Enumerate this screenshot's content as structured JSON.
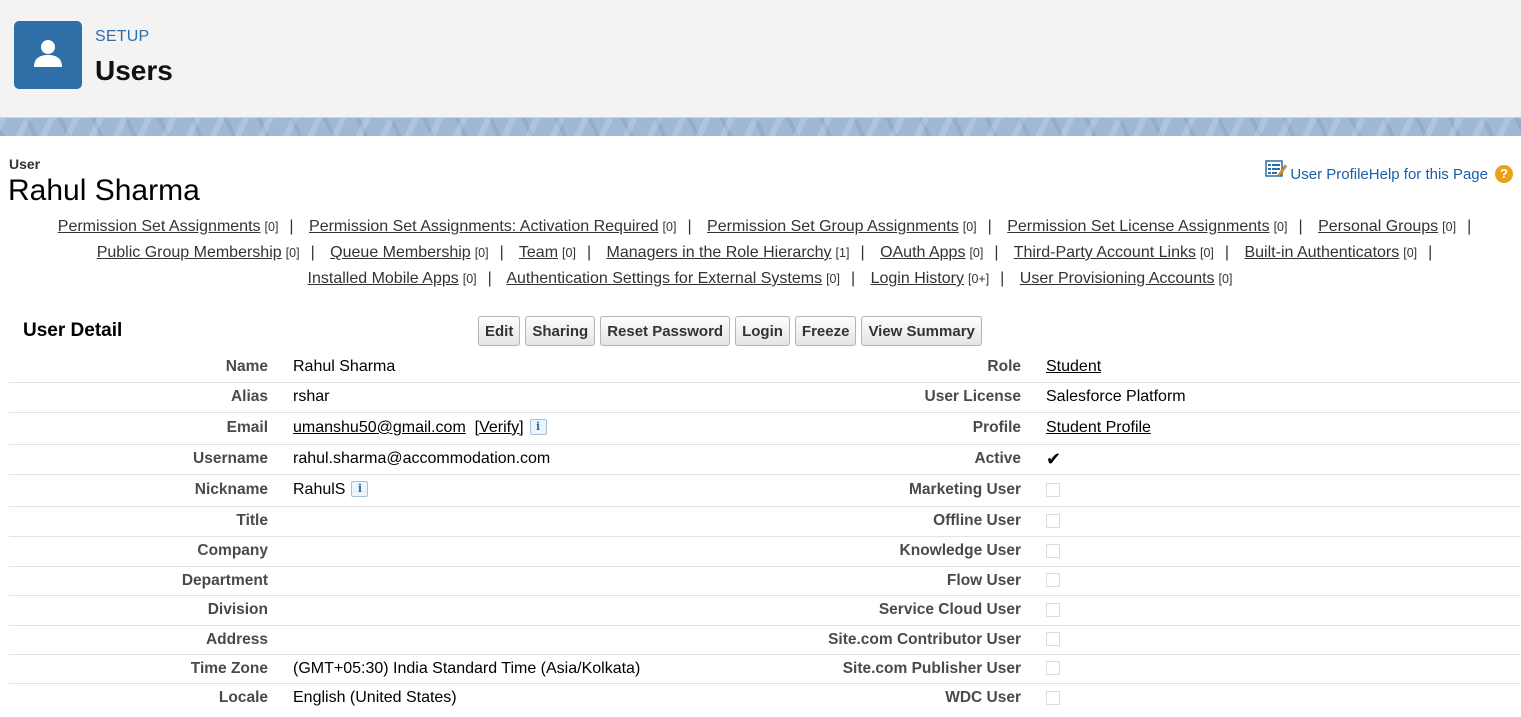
{
  "header": {
    "setup_label": "SETUP",
    "title": "Users"
  },
  "user": {
    "type_label": "User",
    "name": "Rahul Sharma"
  },
  "help": {
    "profile_link": "User Profile",
    "help_link": "Help for this Page",
    "help_symbol": "?"
  },
  "related_links": [
    {
      "label": "Permission Set Assignments",
      "count": "[0]"
    },
    {
      "label": "Permission Set Assignments: Activation Required",
      "count": "[0]"
    },
    {
      "label": "Permission Set Group Assignments",
      "count": "[0]"
    },
    {
      "label": "Permission Set License Assignments",
      "count": "[0]"
    },
    {
      "label": "Personal Groups",
      "count": "[0]"
    },
    {
      "label": "Public Group Membership",
      "count": "[0]"
    },
    {
      "label": "Queue Membership",
      "count": "[0]"
    },
    {
      "label": "Team",
      "count": "[0]"
    },
    {
      "label": "Managers in the Role Hierarchy",
      "count": "[1]"
    },
    {
      "label": "OAuth Apps",
      "count": "[0]"
    },
    {
      "label": "Third-Party Account Links",
      "count": "[0]"
    },
    {
      "label": "Built-in Authenticators",
      "count": "[0]"
    },
    {
      "label": "Installed Mobile Apps",
      "count": "[0]"
    },
    {
      "label": "Authentication Settings for External Systems",
      "count": "[0]"
    },
    {
      "label": "Login History",
      "count": "[0+]"
    },
    {
      "label": "User Provisioning Accounts",
      "count": "[0]"
    }
  ],
  "detail": {
    "title": "User Detail",
    "buttons": [
      "Edit",
      "Sharing",
      "Reset Password",
      "Login",
      "Freeze",
      "View Summary"
    ],
    "rows": [
      {
        "left_label": "Name",
        "left_value": "Rahul Sharma",
        "right_label": "Role",
        "right_value": "Student"
      },
      {
        "left_label": "Alias",
        "left_value": "rshar",
        "right_label": "User License",
        "right_value": "Salesforce Platform"
      },
      {
        "left_label": "Email",
        "left_value": "umanshu50@gmail.com",
        "left_extra": "[Verify]",
        "right_label": "Profile",
        "right_value": "Student Profile"
      },
      {
        "left_label": "Username",
        "left_value": "rahul.sharma@accommodation.com",
        "right_label": "Active",
        "right_value": "✔"
      },
      {
        "left_label": "Nickname",
        "left_value": "RahulS",
        "right_label": "Marketing User",
        "right_value": ""
      },
      {
        "left_label": "Title",
        "left_value": "",
        "right_label": "Offline User",
        "right_value": ""
      },
      {
        "left_label": "Company",
        "left_value": "",
        "right_label": "Knowledge User",
        "right_value": ""
      },
      {
        "left_label": "Department",
        "left_value": "",
        "right_label": "Flow User",
        "right_value": ""
      },
      {
        "left_label": "Division",
        "left_value": "",
        "right_label": "Service Cloud User",
        "right_value": ""
      },
      {
        "left_label": "Address",
        "left_value": "",
        "right_label": "Site.com Contributor User",
        "right_value": ""
      },
      {
        "left_label": "Time Zone",
        "left_value": "(GMT+05:30) India Standard Time (Asia/Kolkata)",
        "right_label": "Site.com Publisher User",
        "right_value": ""
      },
      {
        "left_label": "Locale",
        "left_value": "English (United States)",
        "right_label": "WDC User",
        "right_value": ""
      }
    ],
    "info_symbol": "i"
  },
  "colors": {
    "brand": "#2e6fa8",
    "help_icon": "#e8a21a"
  }
}
